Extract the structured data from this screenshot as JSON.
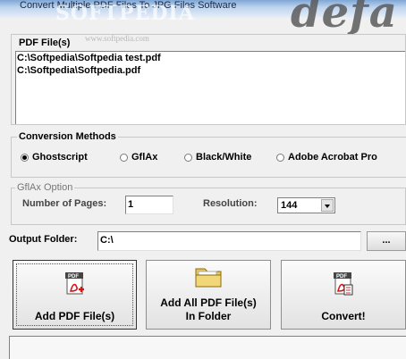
{
  "window": {
    "title": "Convert Multiple PDF Files To JPG Files Software"
  },
  "watermark": {
    "big": "defa",
    "brand": "SOFTPEDIA",
    "url": "www.softpedia.com"
  },
  "pdf_files": {
    "legend": "PDF File(s)",
    "items": [
      "C:\\Softpedia\\Softpedia test.pdf",
      "C:\\Softpedia\\Softpedia.pdf"
    ]
  },
  "conversion": {
    "legend": "Conversion Methods",
    "options": [
      "Ghostscript",
      "GflAx",
      "Black/White",
      "Adobe Acrobat Pro"
    ],
    "selected": "Ghostscript"
  },
  "gflax": {
    "legend": "GflAx Option",
    "pages_label": "Number of Pages:",
    "pages_value": "1",
    "resolution_label": "Resolution:",
    "resolution_value": "144"
  },
  "output": {
    "label": "Output Folder:",
    "value": "C:\\",
    "browse": "..."
  },
  "buttons": {
    "add_files": "Add PDF File(s)",
    "add_folder_line1": "Add All PDF File(s)",
    "add_folder_line2": "In Folder",
    "convert": "Convert!"
  },
  "icons": {
    "pdf": "pdf-file-icon",
    "folder": "folder-icon",
    "convert": "pdf-convert-icon"
  }
}
